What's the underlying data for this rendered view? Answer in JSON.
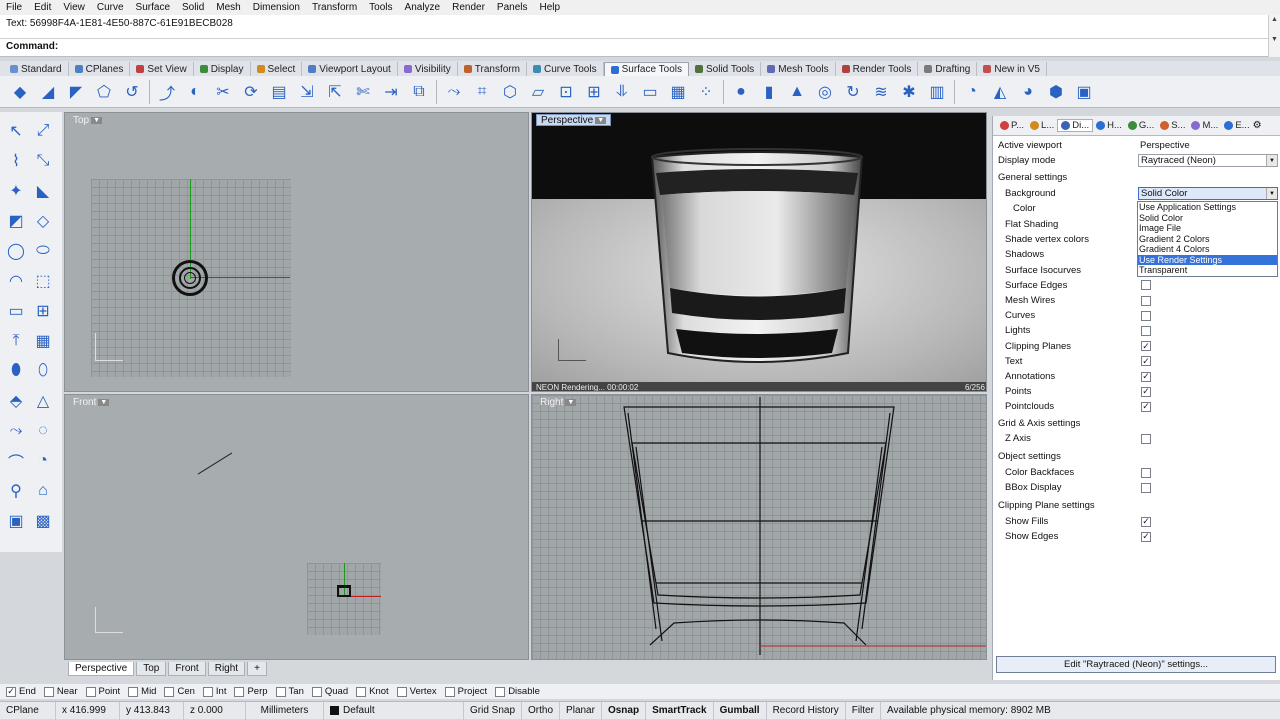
{
  "menu": [
    "File",
    "Edit",
    "View",
    "Curve",
    "Surface",
    "Solid",
    "Mesh",
    "Dimension",
    "Transform",
    "Tools",
    "Analyze",
    "Render",
    "Panels",
    "Help"
  ],
  "command": {
    "history": "Text: 56998F4A-1E81-4E50-887C-61E91BECB028",
    "prompt": "Command:"
  },
  "toolbar_tabs": [
    "Standard",
    "CPlanes",
    "Set View",
    "Display",
    "Select",
    "Viewport Layout",
    "Visibility",
    "Transform",
    "Curve Tools",
    "Surface Tools",
    "Solid Tools",
    "Mesh Tools",
    "Render Tools",
    "Drafting",
    "New in V5"
  ],
  "toolbar_tabs_active": "Surface Tools",
  "viewports": {
    "top": "Top",
    "perspective": "Perspective",
    "front": "Front",
    "right": "Right",
    "render_status": "NEON Rendering... 00:00:02",
    "render_pass": "6/256"
  },
  "viewport_tabs": [
    "Perspective",
    "Top",
    "Front",
    "Right"
  ],
  "panel": {
    "tabs": [
      "P...",
      "L...",
      "Di...",
      "H...",
      "G...",
      "S...",
      "M...",
      "E..."
    ],
    "active_viewport_label": "Active viewport",
    "active_viewport_value": "Perspective",
    "display_mode_label": "Display mode",
    "display_mode_value": "Raytraced (Neon)",
    "general_settings": "General settings",
    "background_label": "Background",
    "background_value": "Solid Color",
    "color_label": "Color",
    "rows": [
      {
        "label": "Flat Shading",
        "checked": false
      },
      {
        "label": "Shade vertex colors",
        "checked": false
      },
      {
        "label": "Shadows",
        "checked": false
      },
      {
        "label": "Surface Isocurves",
        "checked": false
      },
      {
        "label": "Surface Edges",
        "checked": false
      },
      {
        "label": "Mesh Wires",
        "checked": false
      },
      {
        "label": "Curves",
        "checked": false
      },
      {
        "label": "Lights",
        "checked": false
      },
      {
        "label": "Clipping Planes",
        "checked": true
      },
      {
        "label": "Text",
        "checked": true
      },
      {
        "label": "Annotations",
        "checked": true
      },
      {
        "label": "Points",
        "checked": true
      },
      {
        "label": "Pointclouds",
        "checked": true
      }
    ],
    "grid_section": "Grid & Axis settings",
    "z_axis": "Z Axis",
    "object_section": "Object settings",
    "color_backfaces": "Color Backfaces",
    "bbox_display": "BBox Display",
    "clipping_section": "Clipping Plane settings",
    "show_fills": "Show Fills",
    "show_edges": "Show Edges",
    "edit_button": "Edit \"Raytraced (Neon)\" settings..."
  },
  "background_options": [
    "Use Application Settings",
    "Solid Color",
    "Image File",
    "Gradient 2 Colors",
    "Gradient 4 Colors",
    "Use Render Settings",
    "Transparent"
  ],
  "background_highlighted": "Use Render Settings",
  "osnaps": [
    {
      "label": "End",
      "checked": true
    },
    {
      "label": "Near",
      "checked": false
    },
    {
      "label": "Point",
      "checked": false
    },
    {
      "label": "Mid",
      "checked": false
    },
    {
      "label": "Cen",
      "checked": false
    },
    {
      "label": "Int",
      "checked": false
    },
    {
      "label": "Perp",
      "checked": false
    },
    {
      "label": "Tan",
      "checked": false
    },
    {
      "label": "Quad",
      "checked": false
    },
    {
      "label": "Knot",
      "checked": false
    },
    {
      "label": "Vertex",
      "checked": false
    },
    {
      "label": "Project",
      "checked": false
    },
    {
      "label": "Disable",
      "checked": false
    }
  ],
  "status": {
    "cplane": "CPlane",
    "x": "x 416.999",
    "y": "y 413.843",
    "z": "z 0.000",
    "units": "Millimeters",
    "layer": "Default",
    "layer_color": "#111111",
    "grid_snap": "Grid Snap",
    "ortho": "Ortho",
    "planar": "Planar",
    "osnap": "Osnap",
    "smarttrack": "SmartTrack",
    "gumball": "Gumball",
    "record_history": "Record History",
    "filter": "Filter",
    "memory": "Available physical memory: 8902 MB"
  },
  "icons": {
    "toolbar": [
      "extrude-icon",
      "blend-icon",
      "fillet-icon",
      "chamfer-icon",
      "offset-icon",
      "match-icon",
      "merge-icon",
      "split-icon",
      "rebuild-icon",
      "unroll-icon",
      "shrink-icon",
      "untrim-icon",
      "trim-icon",
      "extend-icon",
      "loft-icon",
      "sweep-icon",
      "network-icon",
      "patch-icon",
      "edge-icon",
      "fit-icon",
      "dec-icon",
      "drape-icon",
      "plane-icon",
      "grid-icon",
      "points-icon",
      "sphere-icon",
      "cylinder-icon",
      "cone-icon",
      "torus-icon",
      "revolve-icon",
      "rail-icon",
      "analyze-icon",
      "zebra-icon",
      "curvature-icon",
      "draft-icon",
      "environment-icon",
      "emap-icon",
      "box-edit-icon"
    ]
  }
}
